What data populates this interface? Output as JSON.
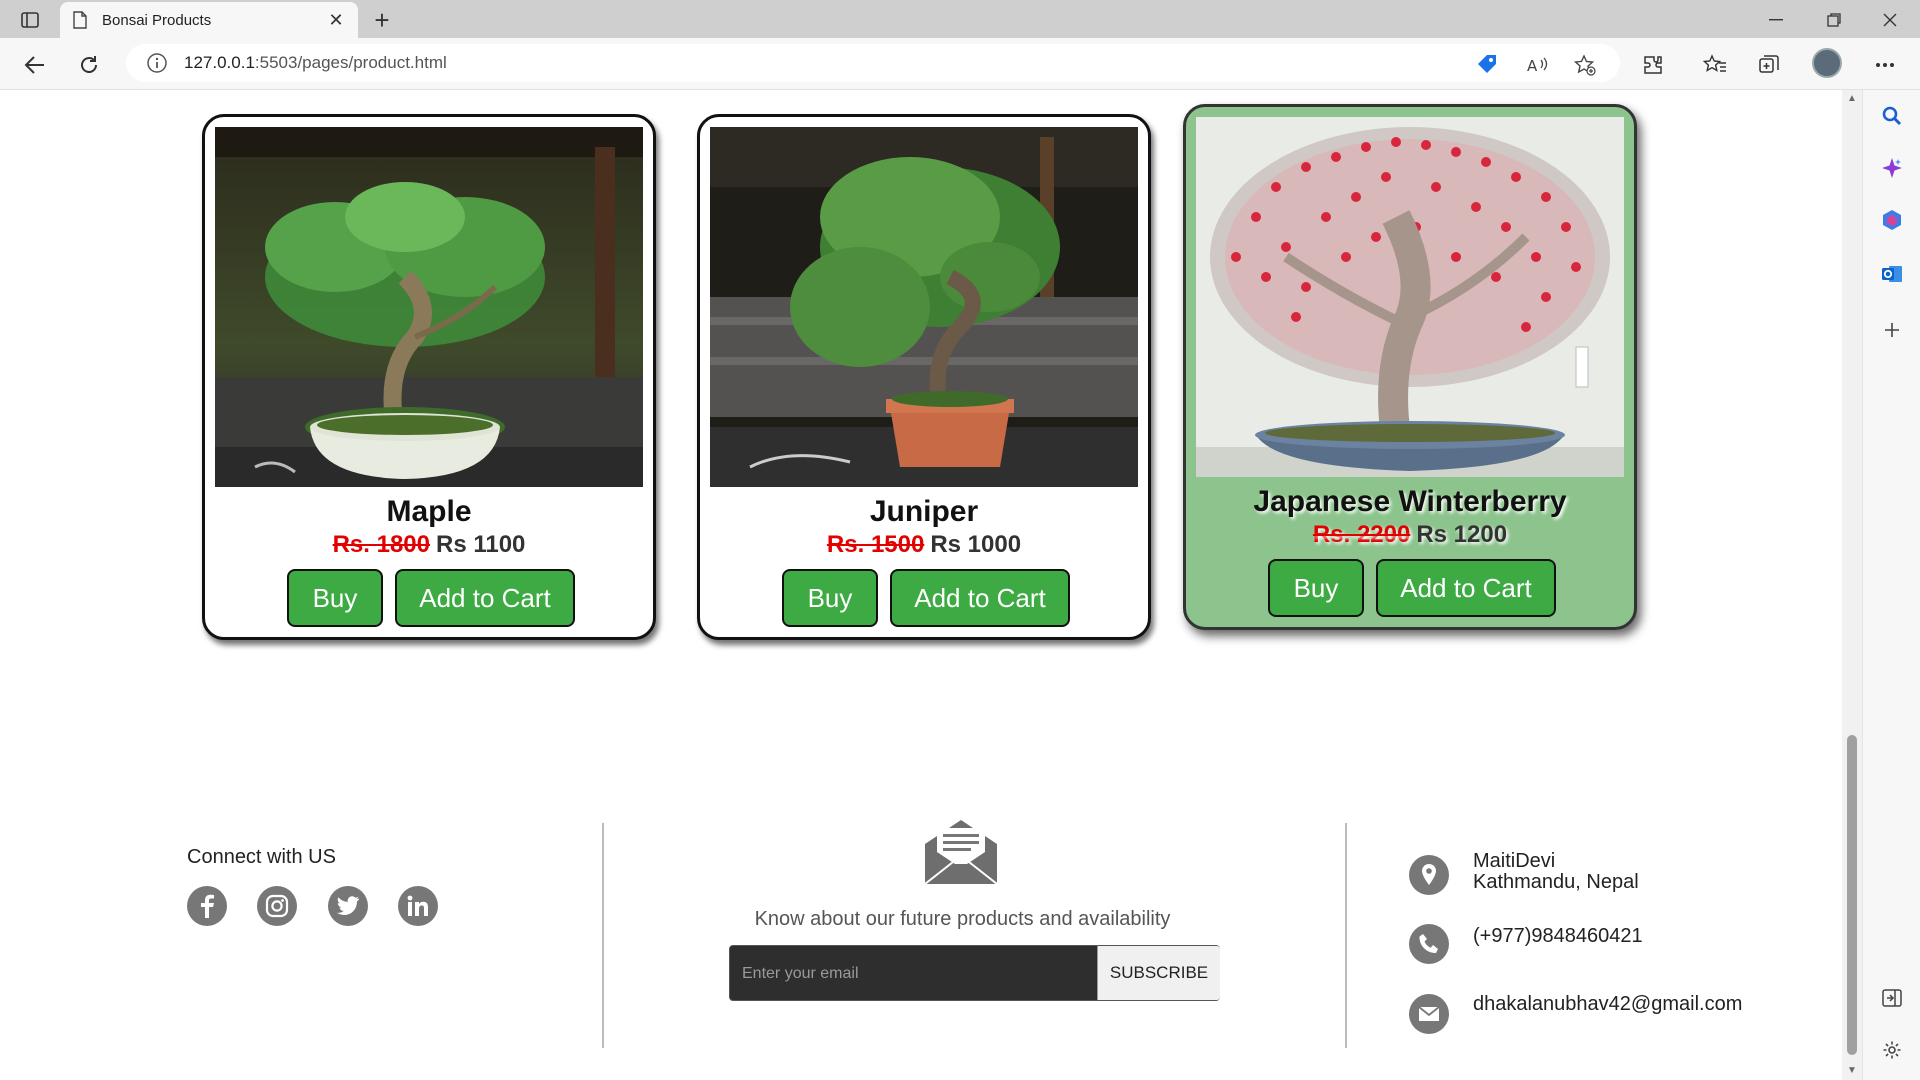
{
  "browser": {
    "tab_title": "Bonsai Products",
    "url_host": "127.0.0.1",
    "url_rest": ":5503/pages/product.html"
  },
  "products": [
    {
      "name": "Maple",
      "old_price": "Rs. 1800",
      "price": "Rs 1100",
      "buy_label": "Buy",
      "cart_label": "Add to Cart"
    },
    {
      "name": "Juniper",
      "old_price": "Rs. 1500",
      "price": "Rs 1000",
      "buy_label": "Buy",
      "cart_label": "Add to Cart"
    },
    {
      "name": "Japanese Winterberry",
      "old_price": "Rs. 2200",
      "price": "Rs 1200",
      "buy_label": "Buy",
      "cart_label": "Add to Cart"
    }
  ],
  "footer": {
    "connect_title": "Connect with US",
    "social_icons": [
      "facebook-icon",
      "instagram-icon",
      "twitter-icon",
      "linkedin-icon"
    ],
    "newsletter_text": "Know about our future products and availability",
    "email_placeholder": "Enter your email",
    "subscribe_label": "SUBSCRIBE",
    "address_line1": "MaitiDevi",
    "address_line2": "Kathmandu, Nepal",
    "phone": "(+977)9848460421",
    "email": "dhakalanubhav42@gmail.com"
  },
  "colors": {
    "button_green": "#3daa44",
    "hover_card": "#8dc48d",
    "old_price_red": "#e20000",
    "icon_gray": "#777777"
  }
}
